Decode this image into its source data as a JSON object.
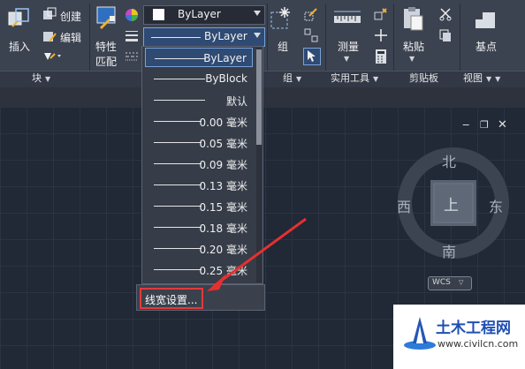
{
  "ribbon": {
    "insert_label": "插入",
    "create_label": "创建",
    "edit_label": "编辑",
    "block_panel": "块",
    "properties_label_1": "特性",
    "properties_label_2": "匹配",
    "color_value": "ByLayer",
    "lineweight_value": "ByLayer",
    "group_label": "组",
    "group_panel": "组",
    "measure_label": "测量",
    "utilities_panel": "实用工具",
    "paste_label": "粘贴",
    "clipboard_panel": "剪贴板",
    "base_label": "基点",
    "view_panel": "视图"
  },
  "dropdown": {
    "items": [
      {
        "label": "ByLayer",
        "selected": true
      },
      {
        "label": "ByBlock"
      },
      {
        "label": "默认"
      },
      {
        "label": "0.00 毫米"
      },
      {
        "label": "0.05 毫米"
      },
      {
        "label": "0.09 毫米"
      },
      {
        "label": "0.13 毫米"
      },
      {
        "label": "0.15 毫米"
      },
      {
        "label": "0.18 毫米"
      },
      {
        "label": "0.20 毫米"
      },
      {
        "label": "0.25 毫米"
      }
    ],
    "settings_label": "线宽设置..."
  },
  "viewcube": {
    "north": "北",
    "south": "南",
    "east": "东",
    "west": "西",
    "top": "上",
    "wcs": "WCS"
  },
  "watermark": {
    "title": "土木工程网",
    "url": "www.civilcn.com"
  }
}
